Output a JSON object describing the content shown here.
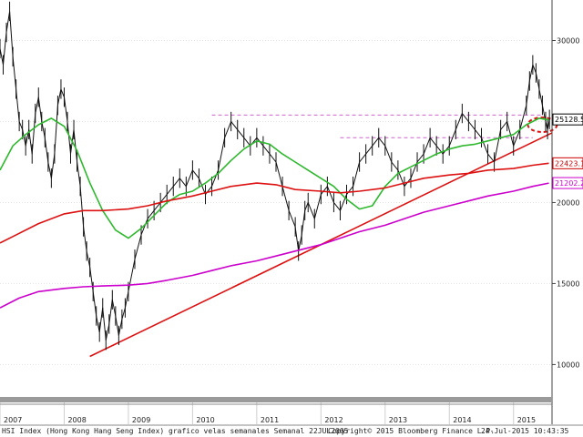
{
  "chart_data": {
    "type": "line",
    "title": "",
    "xlabel": "",
    "ylabel": "",
    "ylim": [
      8000,
      32500
    ],
    "xlim": [
      2007.0,
      2015.6
    ],
    "grid": true,
    "y_ticks": [
      10000,
      15000,
      20000,
      25000,
      30000
    ],
    "y_tick_labels": [
      "10000",
      "15000",
      "20000",
      "25000",
      "30000"
    ],
    "x_tick_labels": [
      "2007",
      "2008",
      "2009",
      "2010",
      "2011",
      "2012",
      "2013",
      "2014",
      "2015"
    ],
    "value_badges": [
      {
        "label": "25128.51",
        "value": 25128.51,
        "bg": "#ffffff",
        "fg": "#000000",
        "border": "#000000"
      },
      {
        "label": "22423.15",
        "value": 22423.15,
        "bg": "#ffffff",
        "fg": "#cc0000",
        "border": "#cc0000"
      },
      {
        "label": "21202.25",
        "value": 21202.25,
        "bg": "#ffffff",
        "fg": "#cc00cc",
        "border": "#cc00cc"
      }
    ],
    "series": [
      {
        "color": "#111111",
        "x": [
          2007.0,
          2007.05,
          2007.1,
          2007.15,
          2007.2,
          2007.25,
          2007.3,
          2007.35,
          2007.4,
          2007.45,
          2007.5,
          2007.55,
          2007.6,
          2007.65,
          2007.7,
          2007.75,
          2007.8,
          2007.85,
          2007.9,
          2007.95,
          2008.0,
          2008.05,
          2008.1,
          2008.15,
          2008.2,
          2008.25,
          2008.3,
          2008.35,
          2008.4,
          2008.45,
          2008.5,
          2008.55,
          2008.6,
          2008.65,
          2008.7,
          2008.75,
          2008.8,
          2008.85,
          2008.9,
          2008.95,
          2009.0,
          2009.1,
          2009.2,
          2009.3,
          2009.4,
          2009.5,
          2009.6,
          2009.7,
          2009.8,
          2009.9,
          2010.0,
          2010.1,
          2010.2,
          2010.3,
          2010.4,
          2010.5,
          2010.6,
          2010.7,
          2010.8,
          2010.9,
          2011.0,
          2011.1,
          2011.2,
          2011.3,
          2011.4,
          2011.5,
          2011.6,
          2011.65,
          2011.7,
          2011.75,
          2011.8,
          2011.9,
          2012.0,
          2012.1,
          2012.2,
          2012.3,
          2012.4,
          2012.5,
          2012.6,
          2012.7,
          2012.8,
          2012.9,
          2013.0,
          2013.1,
          2013.2,
          2013.3,
          2013.4,
          2013.5,
          2013.6,
          2013.7,
          2013.8,
          2013.9,
          2014.0,
          2014.1,
          2014.2,
          2014.3,
          2014.4,
          2014.5,
          2014.6,
          2014.7,
          2014.8,
          2014.9,
          2015.0,
          2015.1,
          2015.2,
          2015.25,
          2015.3,
          2015.35,
          2015.4,
          2015.45,
          2015.5,
          2015.53,
          2015.56
        ],
        "values": [
          29500,
          28500,
          30500,
          31800,
          29000,
          27000,
          25000,
          24500,
          23500,
          24500,
          23000,
          25500,
          26500,
          25000,
          24000,
          22500,
          21500,
          23000,
          26000,
          27000,
          26500,
          25000,
          23000,
          24500,
          22500,
          21000,
          18500,
          17000,
          16000,
          14500,
          13000,
          12000,
          13500,
          11500,
          12500,
          14000,
          13000,
          11800,
          12800,
          13500,
          14500,
          16500,
          18000,
          19000,
          19500,
          20000,
          20500,
          21000,
          21500,
          21000,
          22000,
          21500,
          20500,
          21000,
          22000,
          24000,
          25000,
          24500,
          24000,
          23500,
          24000,
          23500,
          23000,
          22500,
          21000,
          19500,
          18500,
          17000,
          18000,
          19500,
          20000,
          19000,
          20500,
          21000,
          20000,
          19500,
          20500,
          21000,
          22500,
          23000,
          23500,
          24000,
          23500,
          22500,
          22000,
          21000,
          21500,
          22500,
          23000,
          24000,
          23500,
          23000,
          23500,
          24500,
          25500,
          25000,
          24500,
          24000,
          23000,
          22500,
          24500,
          25000,
          23500,
          24500,
          26000,
          27500,
          28500,
          28000,
          27000,
          26000,
          25000,
          24500,
          25128.51
        ]
      },
      {
        "color": "#2db82d",
        "x": [
          2007.0,
          2007.2,
          2007.4,
          2007.6,
          2007.8,
          2008.0,
          2008.2,
          2008.4,
          2008.6,
          2008.8,
          2009.0,
          2009.2,
          2009.4,
          2009.6,
          2009.8,
          2010.0,
          2010.2,
          2010.4,
          2010.6,
          2010.8,
          2011.0,
          2011.2,
          2011.4,
          2011.6,
          2011.8,
          2012.0,
          2012.2,
          2012.4,
          2012.6,
          2012.8,
          2013.0,
          2013.2,
          2013.4,
          2013.6,
          2013.8,
          2014.0,
          2014.2,
          2014.4,
          2014.6,
          2014.8,
          2015.0,
          2015.2,
          2015.4,
          2015.55
        ],
        "values": [
          22000,
          23500,
          24200,
          24800,
          25200,
          24700,
          23200,
          21200,
          19500,
          18300,
          17800,
          18400,
          19200,
          20000,
          20500,
          20700,
          21200,
          21800,
          22600,
          23300,
          23800,
          23600,
          23000,
          22500,
          22000,
          21500,
          21000,
          20200,
          19600,
          19800,
          21000,
          21800,
          22200,
          22600,
          23000,
          23300,
          23500,
          23600,
          23800,
          24000,
          24200,
          24800,
          25200,
          25100
        ]
      },
      {
        "color": "#dd1111",
        "x": [
          2007.0,
          2007.3,
          2007.6,
          2008.0,
          2008.3,
          2008.6,
          2009.0,
          2009.3,
          2009.6,
          2010.0,
          2010.3,
          2010.6,
          2011.0,
          2011.3,
          2011.6,
          2012.0,
          2012.3,
          2012.6,
          2013.0,
          2013.3,
          2013.6,
          2014.0,
          2014.3,
          2014.6,
          2015.0,
          2015.3,
          2015.55
        ],
        "values": [
          17500,
          18100,
          18700,
          19300,
          19500,
          19500,
          19600,
          19800,
          20100,
          20400,
          20700,
          21000,
          21200,
          21100,
          20800,
          20700,
          20600,
          20700,
          20900,
          21200,
          21500,
          21700,
          21800,
          22000,
          22100,
          22300,
          22423.15
        ]
      },
      {
        "color": "#cc00cc",
        "x": [
          2007.0,
          2007.3,
          2007.6,
          2008.0,
          2008.3,
          2008.6,
          2009.0,
          2009.3,
          2009.6,
          2010.0,
          2010.3,
          2010.6,
          2011.0,
          2011.3,
          2011.6,
          2012.0,
          2012.3,
          2012.6,
          2013.0,
          2013.3,
          2013.6,
          2014.0,
          2014.3,
          2014.6,
          2015.0,
          2015.3,
          2015.55
        ],
        "values": [
          13500,
          14100,
          14500,
          14700,
          14800,
          14850,
          14900,
          15000,
          15200,
          15500,
          15800,
          16100,
          16400,
          16700,
          17000,
          17400,
          17800,
          18200,
          18600,
          19000,
          19400,
          19800,
          20100,
          20400,
          20700,
          21000,
          21202.25
        ]
      }
    ],
    "trendlines": [
      {
        "kind": "support",
        "color": "#dd1111",
        "x": [
          2008.4,
          2015.6
        ],
        "values": [
          10500,
          24300
        ]
      },
      {
        "kind": "resistance",
        "color": "#cc66cc",
        "dashed": true,
        "x": [
          2010.3,
          2015.45
        ],
        "values": [
          25400,
          25400
        ]
      },
      {
        "kind": "resistance",
        "color": "#cc66cc",
        "dashed": true,
        "x": [
          2012.3,
          2015.3
        ],
        "values": [
          24000,
          24000
        ]
      }
    ],
    "highlight": {
      "kind": "ellipse",
      "color": "#dd1111",
      "x": 2015.45,
      "value": 24800
    }
  },
  "footer": {
    "left_text": "HSI Index (Hong Kong Hang Seng Index) grafico velas semanales  Semanal 22JUL2005",
    "center_text": "Copyright© 2015 Bloomberg Finance L.P.",
    "right_text": "24-Jul-2015 10:43:35"
  }
}
